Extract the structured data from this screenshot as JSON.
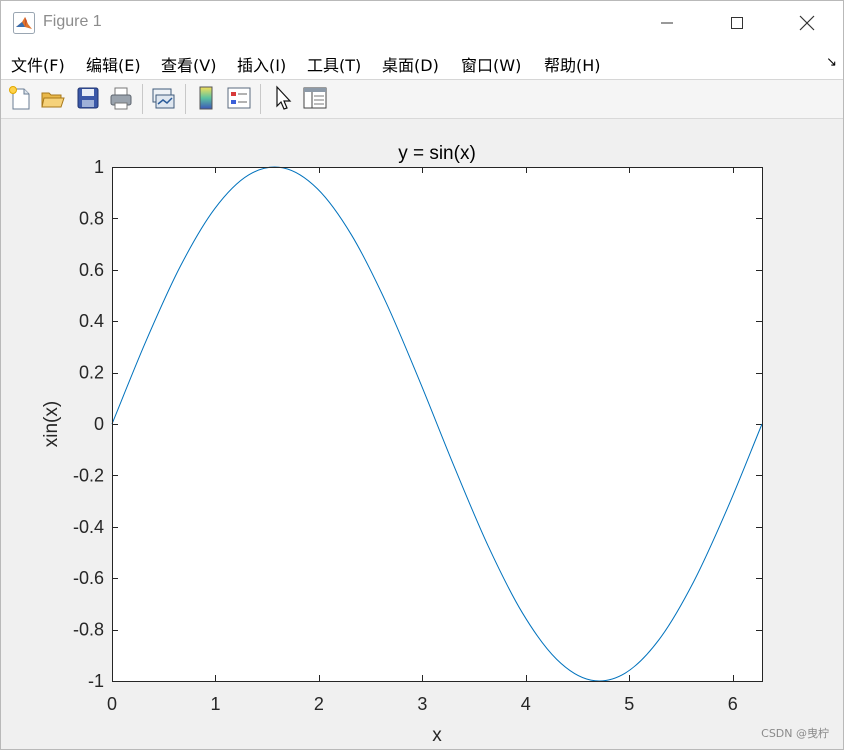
{
  "window": {
    "title": "Figure 1",
    "icon": "matlab-logo-icon",
    "controls": [
      "minimize-icon",
      "maximize-icon",
      "close-icon"
    ]
  },
  "menu": {
    "items": [
      {
        "label": "文件(F)"
      },
      {
        "label": "编辑(E)"
      },
      {
        "label": "查看(V)"
      },
      {
        "label": "插入(I)"
      },
      {
        "label": "工具(T)"
      },
      {
        "label": "桌面(D)"
      },
      {
        "label": "窗口(W)"
      },
      {
        "label": "帮助(H)"
      }
    ],
    "dock_glyph": "↘"
  },
  "toolbar": {
    "buttons": [
      "new-figure-icon",
      "open-file-icon",
      "save-icon",
      "print-icon",
      "link-plot-icon",
      "insert-colorbar-icon",
      "insert-legend-icon",
      "edit-plot-icon",
      "property-inspector-icon"
    ]
  },
  "chart_data": {
    "type": "line",
    "title": "y = sin(x)",
    "xlabel": "x",
    "ylabel": "xin(x)",
    "xlim": [
      0,
      6.2832
    ],
    "ylim": [
      -1,
      1
    ],
    "xticks": [
      0,
      1,
      2,
      3,
      4,
      5,
      6
    ],
    "yticks": [
      -1,
      -0.8,
      -0.6,
      -0.4,
      -0.2,
      0,
      0.2,
      0.4,
      0.6,
      0.8,
      1
    ],
    "ytick_labels": [
      "-1",
      "-0.8",
      "-0.6",
      "-0.4",
      "-0.2",
      "0",
      "0.2",
      "0.4",
      "0.6",
      "0.8",
      "1"
    ],
    "grid": false,
    "series": [
      {
        "color": "#0072bd",
        "x": [
          0,
          0.3307,
          0.6614,
          0.9921,
          1.3228,
          1.6535,
          1.9842,
          2.3149,
          2.6456,
          2.9762,
          3.3069,
          3.6376,
          3.9683,
          4.299,
          4.6297,
          4.9604,
          5.2911,
          5.6218,
          5.9525,
          6.2832
        ],
        "y": [
          0,
          0.3247,
          0.6142,
          0.8372,
          0.9694,
          0.9966,
          0.9158,
          0.7357,
          0.4759,
          0.1646,
          -0.1646,
          -0.4759,
          -0.7357,
          -0.9158,
          -0.9966,
          -0.9694,
          -0.8372,
          -0.6142,
          -0.3247,
          0
        ]
      }
    ]
  },
  "watermark": "CSDN @曳柠"
}
